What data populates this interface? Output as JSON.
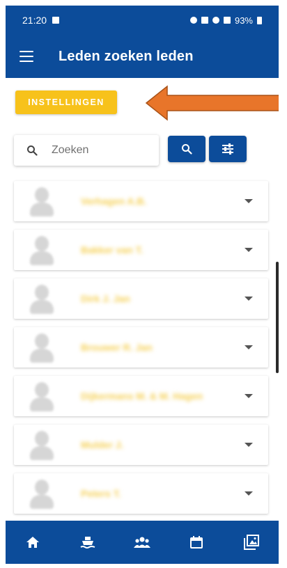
{
  "status_bar": {
    "time": "21:20",
    "battery": "93%"
  },
  "app_bar": {
    "title": "Leden zoeken leden"
  },
  "settings_button": {
    "label": "INSTELLINGEN"
  },
  "search": {
    "placeholder": "Zoeken"
  },
  "members": [
    {
      "name": "Verhagen A.B."
    },
    {
      "name": "Bakker van T."
    },
    {
      "name": "Dirk J. Jan"
    },
    {
      "name": "Brouwer R. Jan"
    },
    {
      "name": "Dijkermans M. & M. Hagen"
    },
    {
      "name": "Mulder J."
    },
    {
      "name": "Peters T."
    }
  ],
  "colors": {
    "primary": "#0c4c9a",
    "accent": "#f7c21b",
    "annotation_arrow": "#e8752a"
  },
  "icons": {
    "menu": "menu-icon",
    "search": "search-icon",
    "filter": "tune-icon",
    "nav": [
      "home-icon",
      "boat-icon",
      "group-icon",
      "calendar-icon",
      "photo-icon"
    ]
  }
}
